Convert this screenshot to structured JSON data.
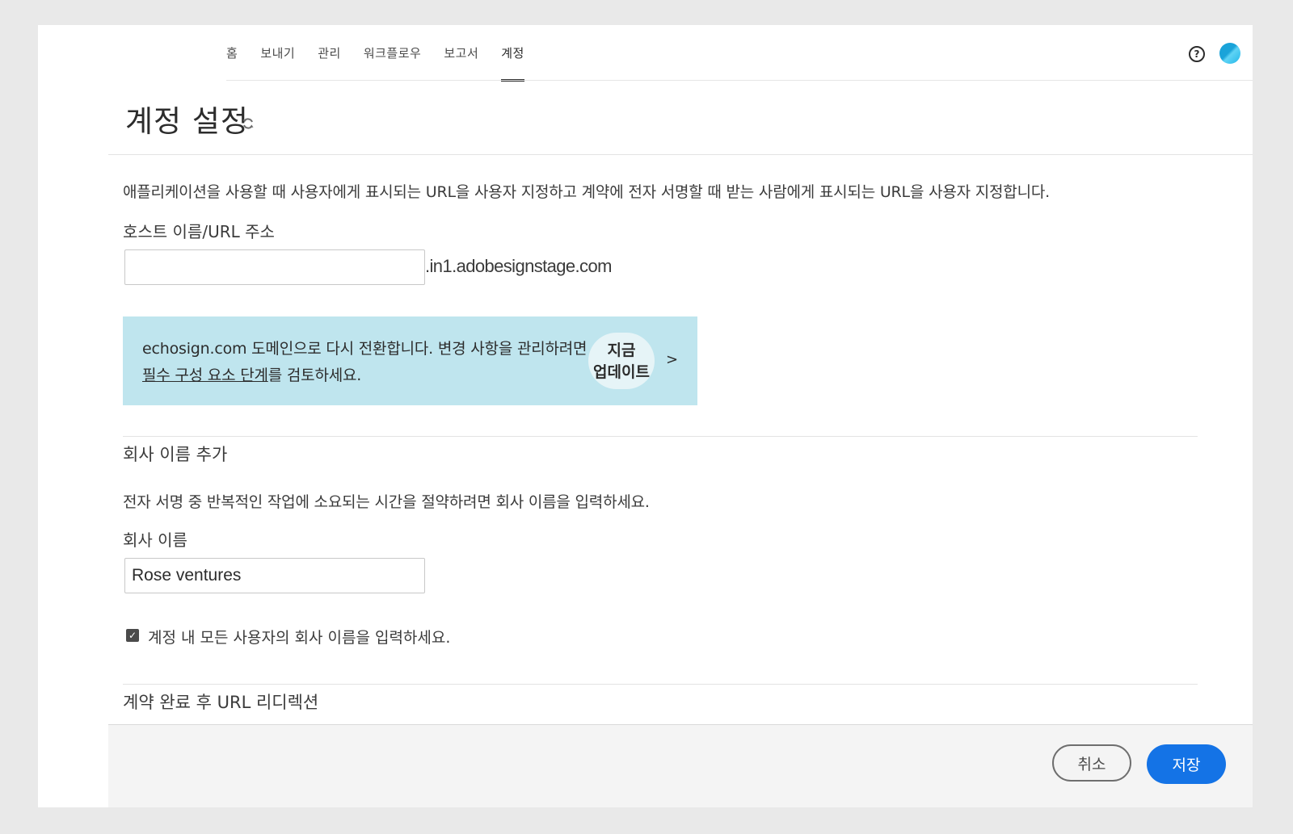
{
  "nav": {
    "items": [
      {
        "label": "홈"
      },
      {
        "label": "보내기"
      },
      {
        "label": "관리"
      },
      {
        "label": "워크플로우"
      },
      {
        "label": "보고서"
      },
      {
        "label": "계정",
        "active": true
      }
    ]
  },
  "header": {
    "help_icon": "question-circle-icon",
    "help_glyph": "?",
    "avatar": "user-avatar"
  },
  "page": {
    "title": "계정 설정",
    "refresh_icon": "refresh-icon"
  },
  "hostname": {
    "description": "애플리케이션을 사용할 때 사용자에게 표시되는 URL을 사용자 지정하고 계약에 전자 서명할 때 받는 사람에게 표시되는 URL을 사용자 지정합니다.",
    "label": "호스트 이름/URL 주소",
    "value": "",
    "suffix": ".in1.adobesignstage.com"
  },
  "banner": {
    "text_before": "echosign.com 도메인으로 다시 전환합니다. 변경 사항을 관리하려면",
    "link_text": "필수 구성 요소 단계",
    "text_after": "를 검토하세요.",
    "button_line1": "지금",
    "button_line2": "업데이트",
    "chevron": ">",
    "background": "#bfe5ee"
  },
  "company": {
    "heading": "회사 이름 추가",
    "description": "전자 서명 중 반복적인 작업에 소요되는 시간을 절약하려면 회사 이름을 입력하세요.",
    "label": "회사 이름",
    "value": "Rose ventures",
    "checkbox_label": "계정 내 모든 사용자의 회사 이름을 입력하세요.",
    "checkbox_checked": true,
    "checkmark": "✓"
  },
  "redirect": {
    "heading": "계약 완료 후 URL 리디렉션"
  },
  "footer": {
    "cancel_label": "취소",
    "save_label": "저장",
    "save_color": "#1473e6"
  }
}
